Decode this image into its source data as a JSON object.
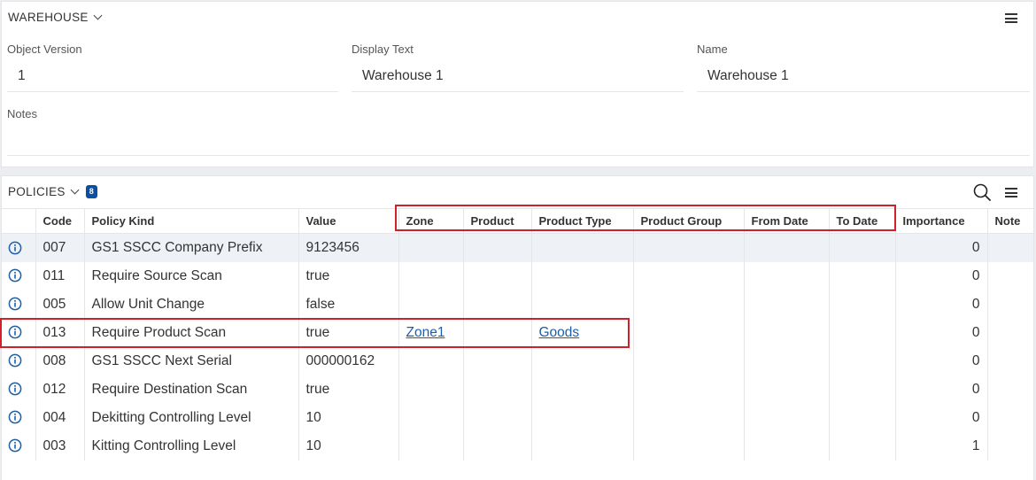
{
  "warehouse": {
    "title": "WAREHOUSE",
    "fields": {
      "object_version_label": "Object Version",
      "object_version_value": "1",
      "display_text_label": "Display Text",
      "display_text_value": "Warehouse 1",
      "name_label": "Name",
      "name_value": "Warehouse 1",
      "notes_label": "Notes",
      "notes_value": ""
    }
  },
  "policies": {
    "title": "POLICIES",
    "count": "8",
    "columns": [
      "",
      "Code",
      "Policy Kind",
      "Value",
      "Zone",
      "Product",
      "Product Type",
      "Product Group",
      "From Date",
      "To Date",
      "Importance",
      "Note"
    ],
    "rows": [
      {
        "code": "007",
        "kind": "GS1 SSCC Company Prefix",
        "value": "9123456",
        "zone": "",
        "product": "",
        "product_type": "",
        "product_group": "",
        "from_date": "",
        "to_date": "",
        "importance": "0",
        "note": ""
      },
      {
        "code": "011",
        "kind": "Require Source Scan",
        "value": "true",
        "zone": "",
        "product": "",
        "product_type": "",
        "product_group": "",
        "from_date": "",
        "to_date": "",
        "importance": "0",
        "note": ""
      },
      {
        "code": "005",
        "kind": "Allow Unit Change",
        "value": "false",
        "zone": "",
        "product": "",
        "product_type": "",
        "product_group": "",
        "from_date": "",
        "to_date": "",
        "importance": "0",
        "note": ""
      },
      {
        "code": "013",
        "kind": "Require Product Scan",
        "value": "true",
        "zone": "Zone1",
        "product": "",
        "product_type": "Goods",
        "product_group": "",
        "from_date": "",
        "to_date": "",
        "importance": "0",
        "note": ""
      },
      {
        "code": "008",
        "kind": "GS1 SSCC Next Serial",
        "value": "000000162",
        "zone": "",
        "product": "",
        "product_type": "",
        "product_group": "",
        "from_date": "",
        "to_date": "",
        "importance": "0",
        "note": ""
      },
      {
        "code": "012",
        "kind": "Require Destination Scan",
        "value": "true",
        "zone": "",
        "product": "",
        "product_type": "",
        "product_group": "",
        "from_date": "",
        "to_date": "",
        "importance": "0",
        "note": ""
      },
      {
        "code": "004",
        "kind": "Dekitting Controlling Level",
        "value": "10",
        "zone": "",
        "product": "",
        "product_type": "",
        "product_group": "",
        "from_date": "",
        "to_date": "",
        "importance": "0",
        "note": ""
      },
      {
        "code": "003",
        "kind": "Kitting Controlling Level",
        "value": "10",
        "zone": "",
        "product": "",
        "product_type": "",
        "product_group": "",
        "from_date": "",
        "to_date": "",
        "importance": "1",
        "note": ""
      }
    ]
  },
  "icons": {
    "info": "info-icon",
    "search": "search-icon",
    "menu": "hamburger-menu-icon",
    "chevron": "chevron-down-icon"
  },
  "colors": {
    "highlight": "#d0202a",
    "badge": "#0b4fa3",
    "link": "#1f5fa8"
  }
}
